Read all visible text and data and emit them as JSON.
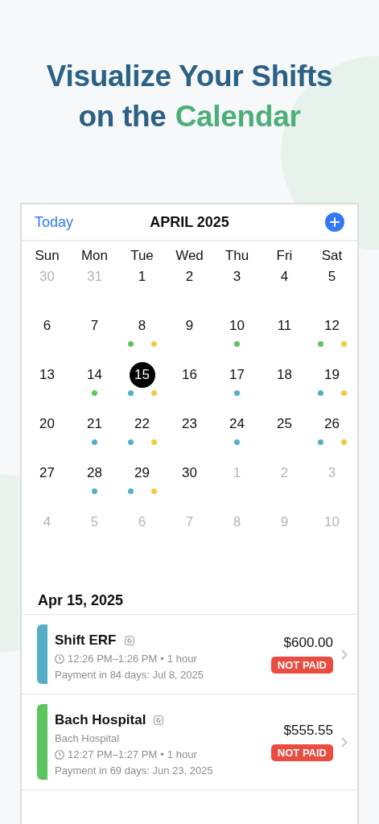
{
  "headline": {
    "line_1": "Visualize Your Shifts",
    "line_2_prefix": "on the",
    "line_2_highlight": "Calendar"
  },
  "calendar": {
    "today_button": "Today",
    "month_title": "APRIL 2025",
    "weekdays": [
      "Sun",
      "Mon",
      "Tue",
      "Wed",
      "Thu",
      "Fri",
      "Sat"
    ],
    "weeks": [
      [
        {
          "day": "30",
          "muted": true,
          "selected": false
        },
        {
          "day": "31",
          "muted": true,
          "selected": false
        },
        {
          "day": "1",
          "muted": false,
          "selected": false
        },
        {
          "day": "2",
          "muted": false,
          "selected": false
        },
        {
          "day": "3",
          "muted": false,
          "selected": false
        },
        {
          "day": "4",
          "muted": false,
          "selected": false
        },
        {
          "day": "5",
          "muted": false,
          "selected": false
        }
      ],
      [
        {
          "day": "6",
          "muted": false,
          "selected": false
        },
        {
          "day": "7",
          "muted": false,
          "selected": false
        },
        {
          "day": "8",
          "muted": false,
          "selected": false,
          "dots": [
            {
              "color": "#5cc55e"
            },
            {
              "color": "#f5c842"
            }
          ]
        },
        {
          "day": "9",
          "muted": false,
          "selected": false
        },
        {
          "day": "10",
          "muted": false,
          "selected": false,
          "dots": [
            {
              "color": "#5cc55e"
            }
          ]
        },
        {
          "day": "11",
          "muted": false,
          "selected": false
        },
        {
          "day": "12",
          "muted": false,
          "selected": false,
          "dots": [
            {
              "color": "#5cc55e"
            },
            {
              "color": "#f5c842"
            }
          ]
        }
      ],
      [
        {
          "day": "13",
          "muted": false,
          "selected": false
        },
        {
          "day": "14",
          "muted": false,
          "selected": false,
          "dots": [
            {
              "color": "#5cc55e"
            }
          ]
        },
        {
          "day": "15",
          "muted": false,
          "selected": true,
          "dots": [
            {
              "color": "#56aec6"
            },
            {
              "color": "#f5c842"
            }
          ]
        },
        {
          "day": "16",
          "muted": false,
          "selected": false
        },
        {
          "day": "17",
          "muted": false,
          "selected": false,
          "dots": [
            {
              "color": "#56aec6"
            }
          ]
        },
        {
          "day": "18",
          "muted": false,
          "selected": false
        },
        {
          "day": "19",
          "muted": false,
          "selected": false,
          "dots": [
            {
              "color": "#56aec6"
            },
            {
              "color": "#f5c842"
            }
          ]
        }
      ],
      [
        {
          "day": "20",
          "muted": false,
          "selected": false
        },
        {
          "day": "21",
          "muted": false,
          "selected": false,
          "dots": [
            {
              "color": "#56aec6"
            }
          ]
        },
        {
          "day": "22",
          "muted": false,
          "selected": false,
          "dots": [
            {
              "color": "#56aec6"
            },
            {
              "color": "#f5c842"
            }
          ]
        },
        {
          "day": "23",
          "muted": false,
          "selected": false
        },
        {
          "day": "24",
          "muted": false,
          "selected": false,
          "dots": [
            {
              "color": "#56aec6"
            }
          ]
        },
        {
          "day": "25",
          "muted": false,
          "selected": false
        },
        {
          "day": "26",
          "muted": false,
          "selected": false,
          "dots": [
            {
              "color": "#56aec6"
            },
            {
              "color": "#f5c842"
            }
          ]
        }
      ],
      [
        {
          "day": "27",
          "muted": false,
          "selected": false
        },
        {
          "day": "28",
          "muted": false,
          "selected": false,
          "dots": [
            {
              "color": "#56aec6"
            }
          ]
        },
        {
          "day": "29",
          "muted": false,
          "selected": false,
          "dots": [
            {
              "color": "#56aec6"
            },
            {
              "color": "#f5c842"
            }
          ]
        },
        {
          "day": "30",
          "muted": false,
          "selected": false
        },
        {
          "day": "1",
          "muted": true,
          "selected": false
        },
        {
          "day": "2",
          "muted": true,
          "selected": false
        },
        {
          "day": "3",
          "muted": true,
          "selected": false
        }
      ],
      [
        {
          "day": "4",
          "muted": true,
          "selected": false
        },
        {
          "day": "5",
          "muted": true,
          "selected": false
        },
        {
          "day": "6",
          "muted": true,
          "selected": false
        },
        {
          "day": "7",
          "muted": true,
          "selected": false
        },
        {
          "day": "8",
          "muted": true,
          "selected": false
        },
        {
          "day": "9",
          "muted": true,
          "selected": false
        },
        {
          "day": "10",
          "muted": true,
          "selected": false
        }
      ]
    ]
  },
  "day_section": {
    "date": "Apr 15, 2025",
    "shifts": [
      {
        "title": "Shift ERF",
        "color": "#56aec6",
        "time": "12:26 PM–1:26 PM",
        "separator": "•",
        "duration": "1 hour",
        "payment": "Payment in 84 days: Jul 8, 2025",
        "amount": "$600.00",
        "status": "NOT PAID"
      },
      {
        "title": "Bach Hospital",
        "color": "#5cc55e",
        "subtitle": "Bach Hospital",
        "time": "12:27 PM–1:27 PM",
        "separator": "•",
        "duration": "1 hour",
        "payment": "Payment in 69 days: Jun 23, 2025",
        "amount": "$555.55",
        "status": "NOT PAID"
      }
    ]
  }
}
